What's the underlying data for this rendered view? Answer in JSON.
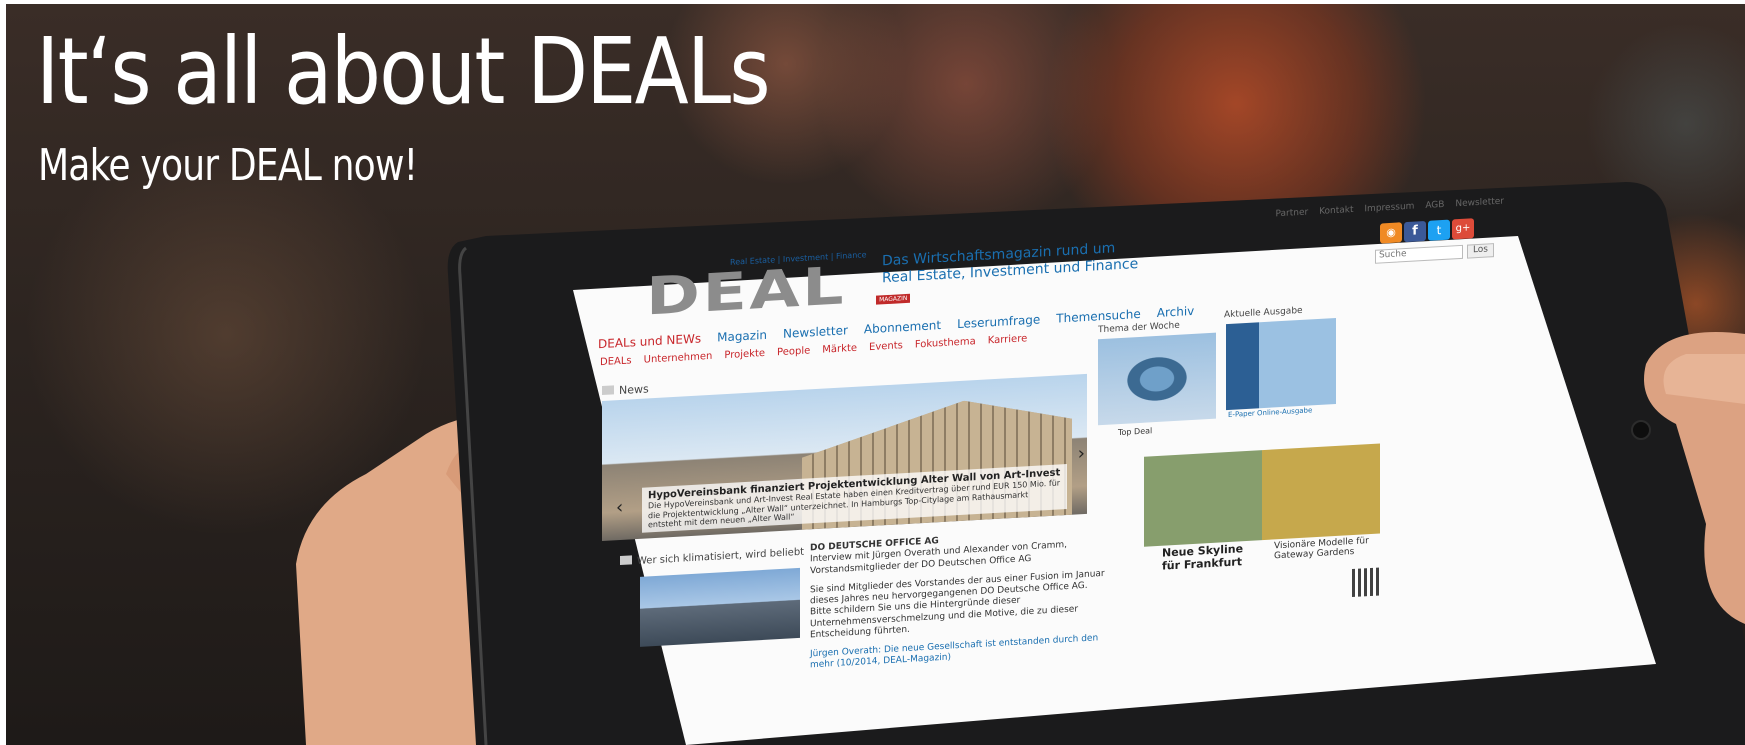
{
  "banner": {
    "headline": "It‘s all about DEALs",
    "subline": "Make your DEAL now!"
  },
  "tablet_screen": {
    "top_links": [
      "Partner",
      "Kontakt",
      "Impressum",
      "AGB",
      "Newsletter"
    ],
    "search_placeholder": "Suche",
    "search_button": "Los",
    "logo": {
      "tagline_top": "Real Estate | Investment | Finance",
      "wordmark": "DEAL",
      "wordmark_sub": "MAGAZIN",
      "slogan_line1": "Das Wirtschaftsmagazin rund um",
      "slogan_line2": "Real Estate, Investment und Finance"
    },
    "main_nav": [
      "DEALs und NEWs",
      "Magazin",
      "Newsletter",
      "Abonnement",
      "Leserumfrage",
      "Themensuche",
      "Archiv"
    ],
    "sub_nav": [
      "DEALs",
      "Unternehmen",
      "Projekte",
      "People",
      "Märkte",
      "Events",
      "Fokusthema",
      "Karriere"
    ],
    "news_label": "News",
    "slider": {
      "headline": "HypoVereinsbank finanziert Projektentwicklung Alter Wall von Art-Invest",
      "text": "Die HypoVereinsbank und Art-Invest Real Estate haben einen Kreditvertrag über rund EUR 150 Mio. für die Projektentwicklung „Alter Wall“ unterzeichnet. In Hamburgs Top-Citylage am Rathausmarkt entsteht mit dem neuen „Alter Wall“"
    },
    "section_label": "Wer sich klimatisiert, wird beliebt",
    "article": {
      "title": "DO DEUTSCHE OFFICE AG",
      "intro": "Interview mit Jürgen Overath und Alexander von Cramm, Vorstandsmitglieder der DO Deutschen Office AG",
      "body": "Sie sind Mitglieder des Vorstandes der aus einer Fusion im Januar dieses Jahres neu hervorgegangenen DO Deutsche Office AG. Bitte schildern Sie uns die Hintergründe dieser Unternehmensverschmelzung und die Motive, die zu dieser Entscheidung führten.",
      "more": "Jürgen Overath: Die neue Gesellschaft ist entstanden durch den mehr (10/2014, DEAL-Magazin)"
    },
    "sidebar": {
      "thema_label": "Thema der Woche",
      "thema_caption": "Top Deal",
      "ausgabe_label": "Aktuelle Ausgabe",
      "ausgabe_caption": "E-Paper Online-Ausgabe",
      "promo1": "Neue Skyline für Frankfurt",
      "promo2": "Visionäre Modelle für Gateway Gardens"
    }
  }
}
